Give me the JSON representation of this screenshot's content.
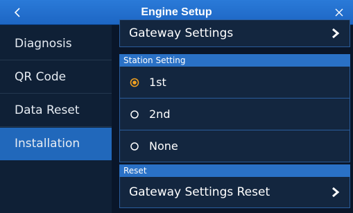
{
  "header": {
    "title": "Engine Setup",
    "back_icon": "chevron-left-icon",
    "close_icon": "close-icon"
  },
  "sidebar": {
    "items": [
      {
        "label": "Diagnosis",
        "active": false
      },
      {
        "label": "QR Code",
        "active": false
      },
      {
        "label": "Data Reset",
        "active": false
      },
      {
        "label": "Installation",
        "active": true
      }
    ]
  },
  "main": {
    "gateway_settings": {
      "label": "Gateway Settings",
      "icon": "chevron-right-icon"
    },
    "station_setting": {
      "header": "Station Setting",
      "options": [
        {
          "label": "1st",
          "selected": true
        },
        {
          "label": "2nd",
          "selected": false
        },
        {
          "label": "None",
          "selected": false
        }
      ]
    },
    "reset": {
      "header": "Reset",
      "gateway_reset": {
        "label": "Gateway Settings Reset",
        "icon": "chevron-right-icon"
      }
    }
  },
  "colors": {
    "title_bar": "#1f6ccb",
    "active_item": "#2168bb",
    "section_header": "#2a71c6",
    "selected_radio": "#f0a020",
    "background": "#0d1b31"
  }
}
